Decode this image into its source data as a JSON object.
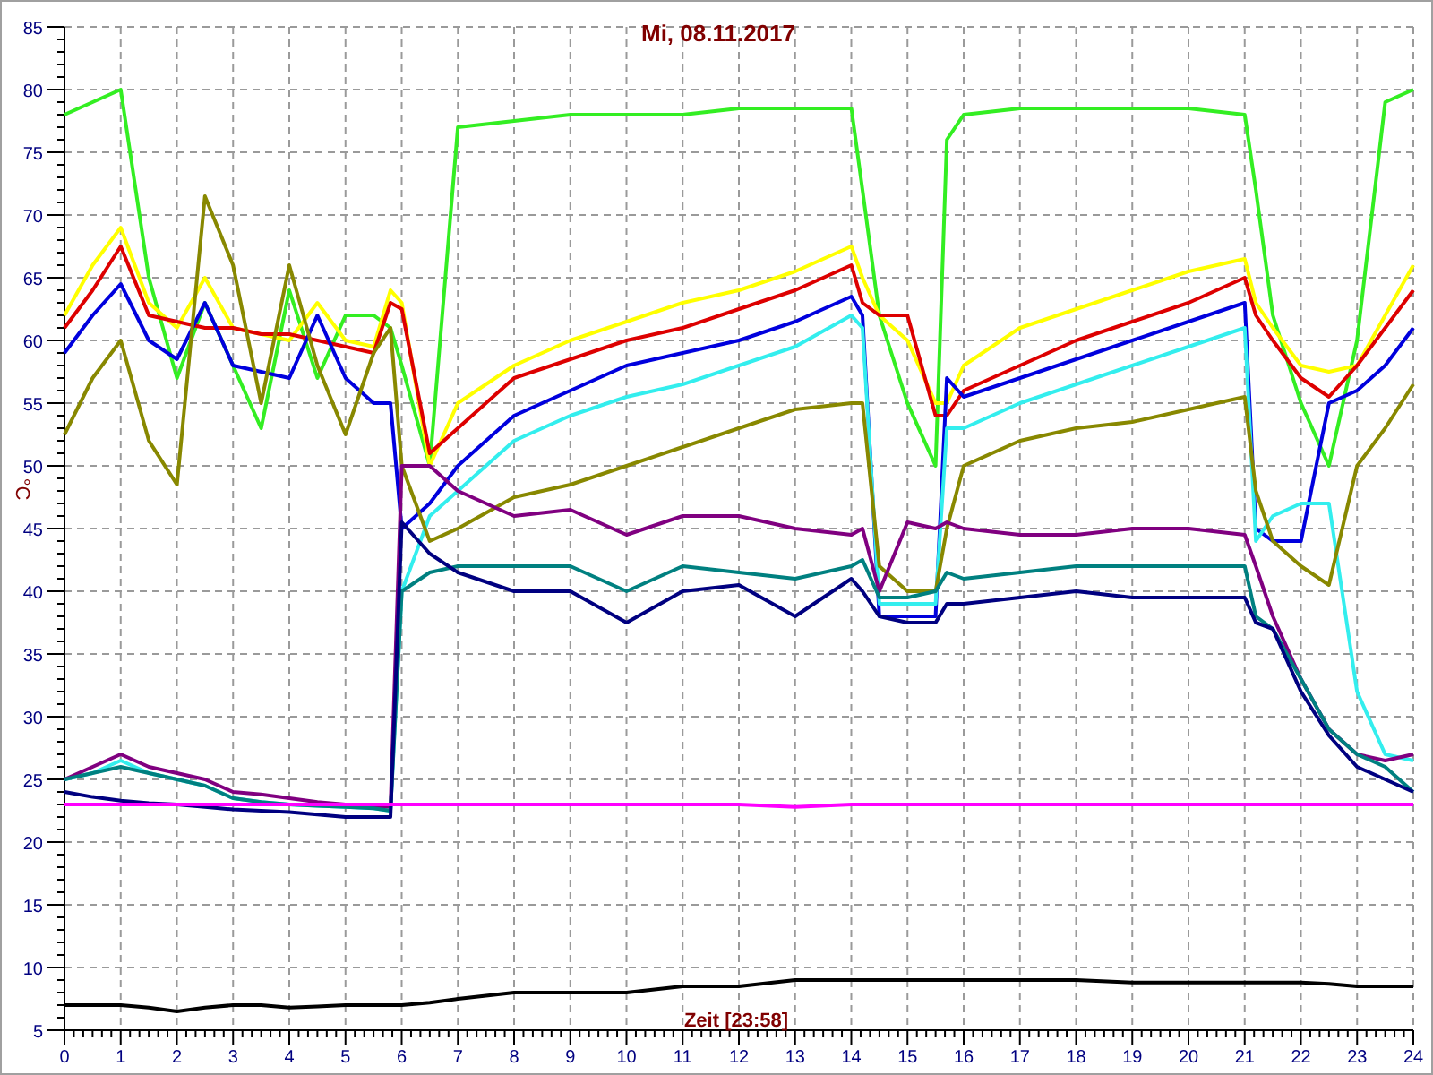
{
  "chart_data": {
    "type": "line",
    "grid": true,
    "title": "Mi, 08.11.2017",
    "xlabel": "Zeit [23:58]",
    "ylabel": "°C",
    "x": [
      0,
      0.5,
      1,
      1.5,
      2,
      2.5,
      3,
      3.5,
      4,
      4.5,
      5,
      5.5,
      5.8,
      6,
      6.5,
      7,
      8,
      9,
      10,
      11,
      12,
      13,
      14,
      14.2,
      14.5,
      15,
      15.5,
      15.7,
      16,
      17,
      18,
      19,
      20,
      21,
      21.2,
      21.5,
      22,
      22.5,
      23,
      23.5,
      24
    ],
    "xlim": [
      0,
      24
    ],
    "ylim": [
      5,
      85
    ],
    "xticks": [
      0,
      1,
      2,
      3,
      4,
      5,
      6,
      7,
      8,
      9,
      10,
      11,
      12,
      13,
      14,
      15,
      16,
      17,
      18,
      19,
      20,
      21,
      22,
      23,
      24
    ],
    "yticks": [
      5,
      10,
      15,
      20,
      25,
      30,
      35,
      40,
      45,
      50,
      55,
      60,
      65,
      70,
      75,
      80,
      85
    ],
    "series": [
      {
        "color": "#33ee22",
        "values": [
          78,
          79,
          80,
          65,
          57,
          63,
          58,
          53,
          64,
          57,
          62,
          62,
          61,
          58,
          50,
          77,
          77.5,
          78,
          78,
          78,
          78.5,
          78.5,
          78.5,
          72,
          62,
          55,
          50,
          76,
          78,
          78.5,
          78.5,
          78.5,
          78.5,
          78,
          72,
          62,
          55,
          50,
          60,
          79,
          80
        ]
      },
      {
        "color": "#ffff00",
        "values": [
          62,
          66,
          69,
          63,
          61,
          65,
          61,
          60.5,
          60,
          63,
          60,
          59.5,
          64,
          63,
          50,
          55,
          58,
          60,
          61.5,
          63,
          64,
          65.5,
          67.5,
          65,
          62,
          60,
          55,
          55,
          58,
          61,
          62.5,
          64,
          65.5,
          66.5,
          63,
          61,
          58,
          57.5,
          58,
          62,
          66
        ]
      },
      {
        "color": "#dd0000",
        "values": [
          61,
          64,
          67.5,
          62,
          61.5,
          61,
          61,
          60.5,
          60.5,
          60,
          59.5,
          59,
          63,
          62.5,
          51,
          53,
          57,
          58.5,
          60,
          61,
          62.5,
          64,
          66,
          63,
          62,
          62,
          54,
          54,
          56,
          58,
          60,
          61.5,
          63,
          65,
          62,
          60,
          57,
          55.5,
          58,
          61,
          64
        ]
      },
      {
        "color": "#0000dd",
        "values": [
          59,
          62,
          64.5,
          60,
          58.5,
          63,
          58,
          57.5,
          57,
          62,
          57,
          55,
          55,
          45,
          47,
          50,
          54,
          56,
          58,
          59,
          60,
          61.5,
          63.5,
          62,
          38,
          38,
          38,
          57,
          55.5,
          57,
          58.5,
          60,
          61.5,
          63,
          45,
          44,
          44,
          55,
          56,
          58,
          61
        ]
      },
      {
        "color": "#33eeee",
        "values": [
          25,
          25.5,
          26.5,
          25.5,
          25,
          24.5,
          23.5,
          23.2,
          23,
          22.9,
          22.8,
          22.7,
          22.5,
          40,
          46,
          48,
          52,
          54,
          55.5,
          56.5,
          58,
          59.5,
          62,
          61,
          39,
          39,
          39,
          53,
          53,
          55,
          56.5,
          58,
          59.5,
          61,
          44,
          46,
          47,
          47,
          32,
          27,
          26.5
        ]
      },
      {
        "color": "#888800",
        "values": [
          52.5,
          57,
          60,
          52,
          48.5,
          71.5,
          66,
          55,
          66,
          58,
          52.5,
          59,
          61,
          50,
          44,
          45,
          47.5,
          48.5,
          50,
          51.5,
          53,
          54.5,
          55,
          55,
          42,
          40,
          40,
          45,
          50,
          52,
          53,
          53.5,
          54.5,
          55.5,
          48,
          44,
          42,
          40.5,
          50,
          53,
          56.5
        ]
      },
      {
        "color": "#800080",
        "values": [
          25,
          26,
          27,
          26,
          25.5,
          25,
          24,
          23.8,
          23.5,
          23.2,
          23,
          22.9,
          22.8,
          50,
          50,
          48,
          46,
          46.5,
          44.5,
          46,
          46,
          45,
          44.5,
          45,
          40,
          45.5,
          45,
          45.5,
          45,
          44.5,
          44.5,
          45,
          45,
          44.5,
          42,
          38,
          33,
          29,
          27,
          26.5,
          27
        ]
      },
      {
        "color": "#008080",
        "values": [
          25,
          25.5,
          26,
          25.5,
          25,
          24.5,
          23.5,
          23.2,
          23,
          22.9,
          22.8,
          22.7,
          22.5,
          40,
          41.5,
          42,
          42,
          42,
          40,
          42,
          41.5,
          41,
          42,
          42.5,
          39.5,
          39.5,
          40,
          41.5,
          41,
          41.5,
          42,
          42,
          42,
          42,
          38,
          37,
          33,
          29,
          27,
          26,
          24
        ]
      },
      {
        "color": "#000080",
        "values": [
          24,
          23.6,
          23.3,
          23.1,
          23,
          22.8,
          22.6,
          22.5,
          22.4,
          22.2,
          22,
          22,
          22,
          45.5,
          43,
          41.5,
          40,
          40,
          37.5,
          40,
          40.5,
          38,
          41,
          40,
          38,
          37.5,
          37.5,
          39,
          39,
          39.5,
          40,
          39.5,
          39.5,
          39.5,
          37.5,
          37,
          32,
          28.5,
          26,
          25,
          24
        ]
      },
      {
        "color": "#ff00ff",
        "values": [
          23,
          23,
          23,
          23,
          23,
          23,
          23,
          23,
          23,
          23,
          23,
          23,
          23,
          23,
          23,
          23,
          23,
          23,
          23,
          23,
          23,
          22.8,
          23,
          23,
          23,
          23,
          23,
          23,
          23,
          23,
          23,
          23,
          23,
          23,
          23,
          23,
          23,
          23,
          23,
          23,
          23
        ]
      },
      {
        "color": "#000000",
        "values": [
          7,
          7,
          7,
          6.8,
          6.5,
          6.8,
          7,
          7,
          6.8,
          6.9,
          7,
          7,
          7,
          7,
          7.2,
          7.5,
          8,
          8,
          8,
          8.5,
          8.5,
          9,
          9,
          9,
          9,
          9,
          9,
          9,
          9,
          9,
          9,
          8.8,
          8.8,
          8.8,
          8.8,
          8.8,
          8.8,
          8.7,
          8.5,
          8.5,
          8.5
        ]
      }
    ]
  }
}
